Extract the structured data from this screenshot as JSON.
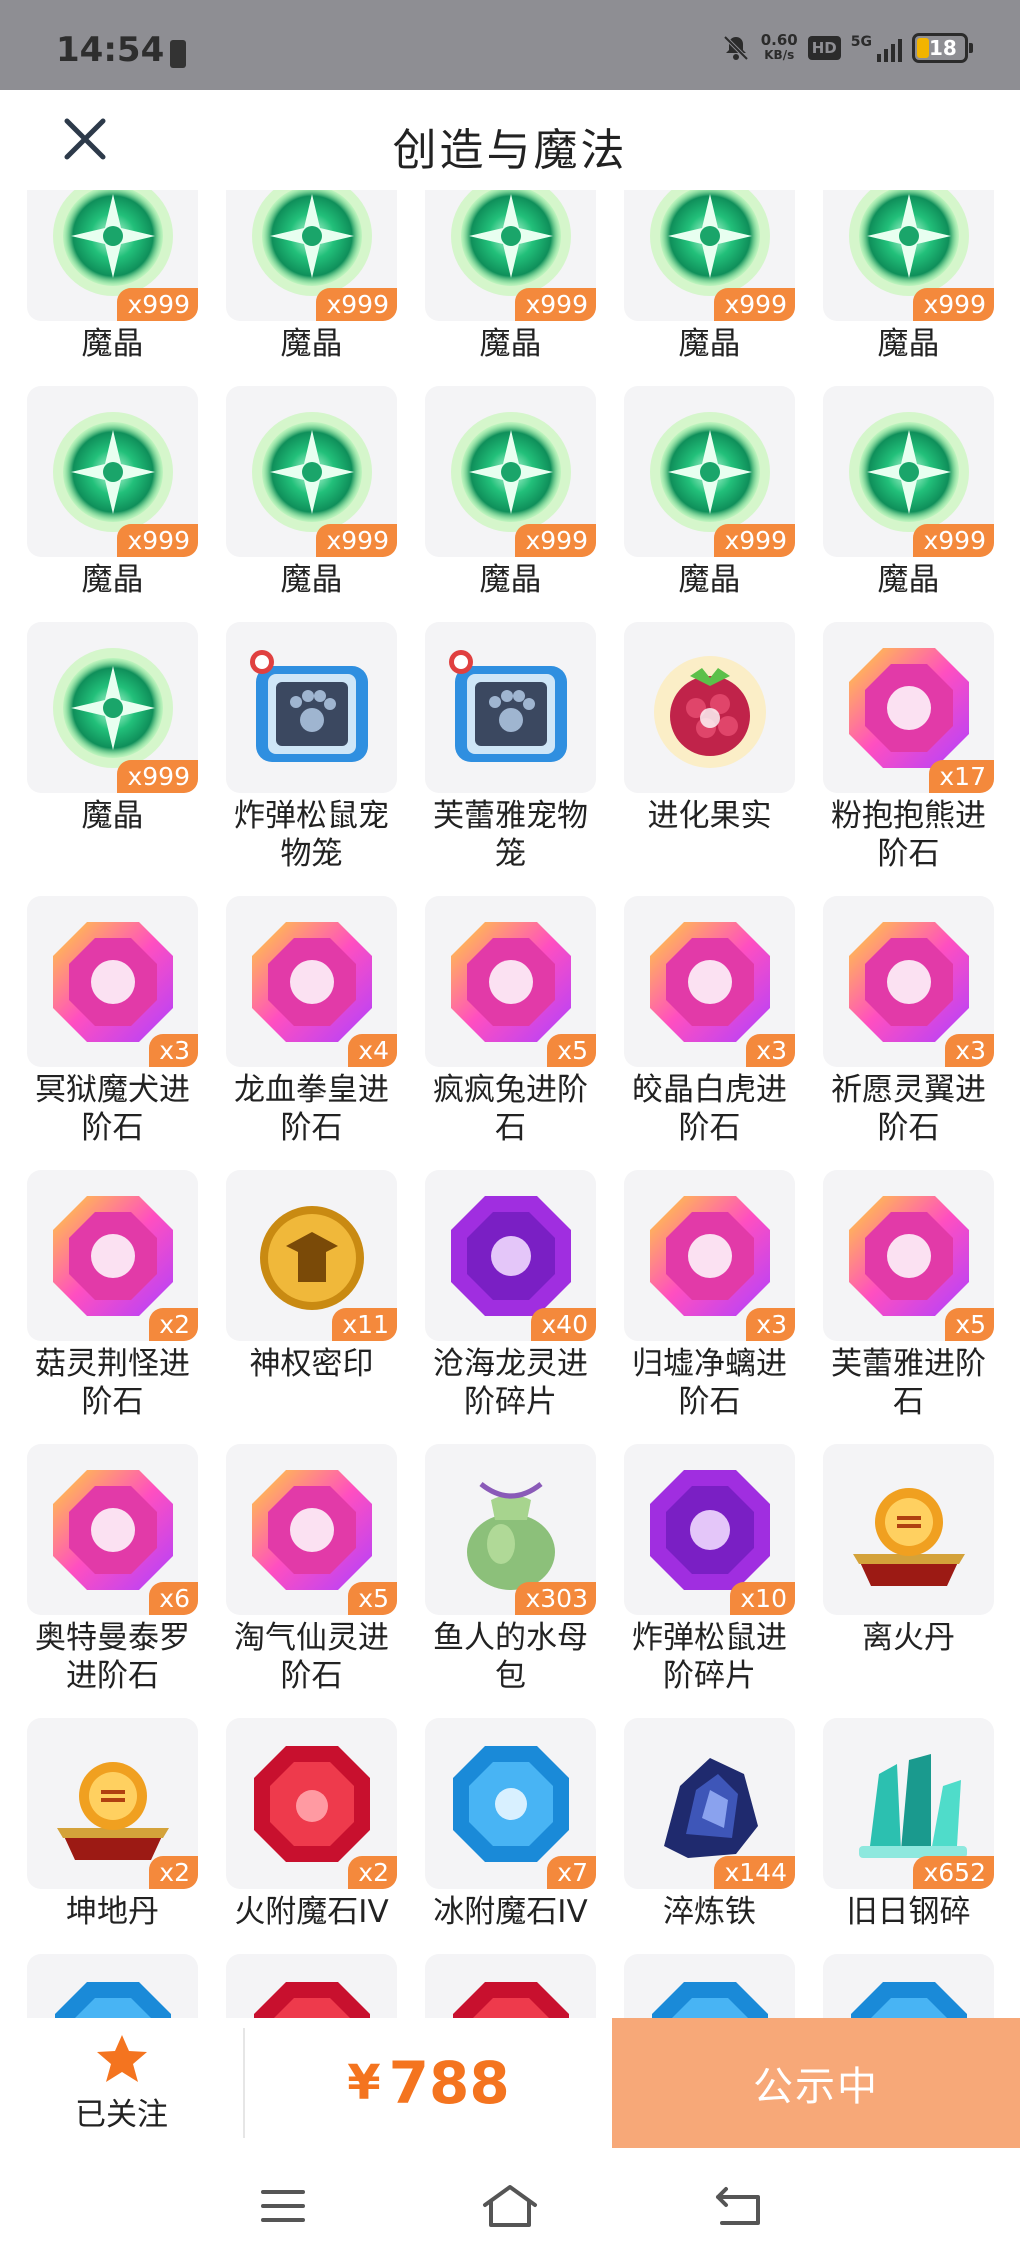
{
  "status_bar": {
    "time": "14:54",
    "net_speed": "0.60",
    "net_unit": "KB/s",
    "hd": "HD",
    "network": "5G",
    "battery": "18"
  },
  "header": {
    "title": "创造与魔法"
  },
  "items": [
    {
      "name": "魔晶",
      "count": "x999",
      "icon": "green-crystal-orb"
    },
    {
      "name": "魔晶",
      "count": "x999",
      "icon": "green-crystal-orb"
    },
    {
      "name": "魔晶",
      "count": "x999",
      "icon": "green-crystal-orb"
    },
    {
      "name": "魔晶",
      "count": "x999",
      "icon": "green-crystal-orb"
    },
    {
      "name": "魔晶",
      "count": "x999",
      "icon": "green-crystal-orb"
    },
    {
      "name": "魔晶",
      "count": "x999",
      "icon": "green-crystal-orb"
    },
    {
      "name": "魔晶",
      "count": "x999",
      "icon": "green-crystal-orb"
    },
    {
      "name": "魔晶",
      "count": "x999",
      "icon": "green-crystal-orb"
    },
    {
      "name": "魔晶",
      "count": "x999",
      "icon": "green-crystal-orb"
    },
    {
      "name": "魔晶",
      "count": "x999",
      "icon": "green-crystal-orb"
    },
    {
      "name": "魔晶",
      "count": "x999",
      "icon": "green-crystal-orb"
    },
    {
      "name": "炸弹松鼠宠物笼",
      "count": "",
      "icon": "pet-cage"
    },
    {
      "name": "芙蕾雅宠物笼",
      "count": "",
      "icon": "pet-cage"
    },
    {
      "name": "进化果实",
      "count": "",
      "icon": "berry-fruit"
    },
    {
      "name": "粉抱抱熊进阶石",
      "count": "x17",
      "icon": "rainbow-gem"
    },
    {
      "name": "冥狱魔犬进阶石",
      "count": "x3",
      "icon": "rainbow-gem"
    },
    {
      "name": "龙血拳皇进阶石",
      "count": "x4",
      "icon": "rainbow-gem"
    },
    {
      "name": "疯疯兔进阶石",
      "count": "x5",
      "icon": "rainbow-gem"
    },
    {
      "name": "皎晶白虎进阶石",
      "count": "x3",
      "icon": "rainbow-gem"
    },
    {
      "name": "祈愿灵翼进阶石",
      "count": "x3",
      "icon": "rainbow-gem"
    },
    {
      "name": "菇灵荆怪进阶石",
      "count": "x2",
      "icon": "rainbow-gem"
    },
    {
      "name": "神权密印",
      "count": "x11",
      "icon": "gold-seal"
    },
    {
      "name": "沧海龙灵进阶碎片",
      "count": "x40",
      "icon": "purple-gem"
    },
    {
      "name": "归墟净螭进阶石",
      "count": "x3",
      "icon": "rainbow-gem"
    },
    {
      "name": "芙蕾雅进阶石",
      "count": "x5",
      "icon": "rainbow-gem"
    },
    {
      "name": "奥特曼泰罗进阶石",
      "count": "x6",
      "icon": "rainbow-gem"
    },
    {
      "name": "淘气仙灵进阶石",
      "count": "x5",
      "icon": "rainbow-gem"
    },
    {
      "name": "鱼人的水母包",
      "count": "x303",
      "icon": "cloth-pouch"
    },
    {
      "name": "炸弹松鼠进阶碎片",
      "count": "x10",
      "icon": "purple-gem"
    },
    {
      "name": "离火丹",
      "count": "",
      "icon": "fire-pill"
    },
    {
      "name": "坤地丹",
      "count": "x2",
      "icon": "fire-pill"
    },
    {
      "name": "火附魔石IV",
      "count": "x2",
      "icon": "red-gem"
    },
    {
      "name": "冰附魔石IV",
      "count": "x7",
      "icon": "blue-gem"
    },
    {
      "name": "淬炼铁",
      "count": "x144",
      "icon": "iron-ore"
    },
    {
      "name": "旧日钢碎",
      "count": "x652",
      "icon": "teal-crystal"
    },
    {
      "name": "",
      "count": "",
      "icon": "blue-gem"
    },
    {
      "name": "",
      "count": "",
      "icon": "red-gem"
    },
    {
      "name": "",
      "count": "",
      "icon": "red-gem"
    },
    {
      "name": "",
      "count": "",
      "icon": "blue-gem"
    },
    {
      "name": "",
      "count": "",
      "icon": "blue-gem"
    }
  ],
  "bottom_bar": {
    "follow_label": "已关注",
    "currency": "¥",
    "price": "788",
    "status_label": "公示中"
  },
  "colors": {
    "accent_orange": "#f4893c",
    "price_orange": "#f4741f",
    "status_button": "#f7a878"
  }
}
